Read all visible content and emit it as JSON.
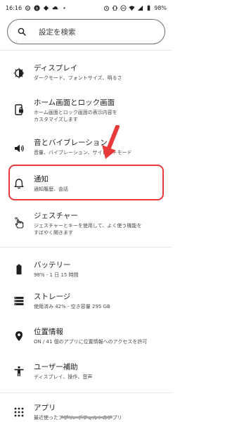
{
  "status": {
    "time": "16:16",
    "battery": "98%"
  },
  "search": {
    "placeholder": "設定を検索"
  },
  "items": [
    {
      "title": "ディスプレイ",
      "sub": "ダークモード、フォントサイズ、明るさ",
      "icon": "display-brightness-icon"
    },
    {
      "title": "ホーム画面とロック画面",
      "sub": "ホーム画面とロック画面の表示内容を\nカスタマイズします",
      "icon": "phone-lock-icon"
    },
    {
      "title": "音とバイブレーション",
      "sub": "音量、バイブレーション、サイレントモード",
      "icon": "volume-icon"
    },
    {
      "title": "通知",
      "sub": "通知履歴、会話",
      "icon": "bell-icon"
    },
    {
      "title": "ジェスチャー",
      "sub": "ジェスチャーとキーを使用して、よく使う機能を\nすばやく開きます",
      "icon": "gesture-hand-icon"
    },
    {
      "title": "バッテリー",
      "sub": "98% - 1 日 15 時間",
      "icon": "battery-icon"
    },
    {
      "title": "ストレージ",
      "sub": "使用済み 42% - 空き容量 295 GB",
      "icon": "storage-icon"
    },
    {
      "title": "位置情報",
      "sub": "ON / 41 個のアプリに位置情報へのアクセスを許可",
      "icon": "location-pin-icon"
    },
    {
      "title": "ユーザー補助",
      "sub": "ディスプレイ、操作、音声",
      "icon": "accessibility-icon"
    },
    {
      "title": "アプリ",
      "sub": "最近使ったアプリ、デフォルトのアプリ",
      "icon": "apps-grid-icon"
    }
  ],
  "colors": {
    "highlight": "#e8393b",
    "arrow": "#e8393b"
  }
}
